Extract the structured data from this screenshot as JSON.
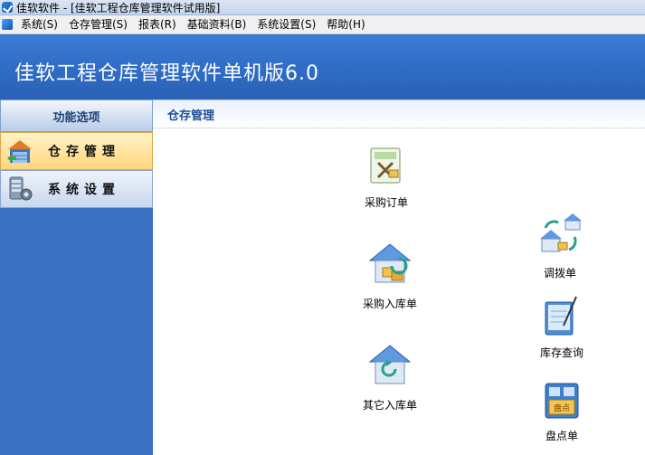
{
  "window": {
    "title": "佳软软件 - [佳软工程仓库管理软件试用版]"
  },
  "menu": [
    "系统(S)",
    "仓存管理(S)",
    "报表(R)",
    "基础资料(B)",
    "系统设置(S)",
    "帮助(H)"
  ],
  "banner": {
    "title": "佳软工程仓库管理软件单机版6.0"
  },
  "sidebar": {
    "header": "功能选项",
    "items": [
      {
        "label": "仓存管理",
        "icon": "warehouse-icon",
        "active": true
      },
      {
        "label": "系统设置",
        "icon": "server-settings-icon",
        "active": false
      }
    ]
  },
  "content": {
    "header": "仓存管理",
    "tiles": [
      {
        "label": "采购订单",
        "icon": "purchase-order-icon"
      },
      {
        "label": "采购入库单",
        "icon": "purchase-inbound-icon"
      },
      {
        "label": "其它入库单",
        "icon": "other-inbound-icon"
      },
      {
        "label": "调拨单",
        "icon": "transfer-icon"
      },
      {
        "label": "库存查询",
        "icon": "inventory-query-icon"
      },
      {
        "label": "盘点单",
        "icon": "stocktake-icon"
      }
    ]
  }
}
